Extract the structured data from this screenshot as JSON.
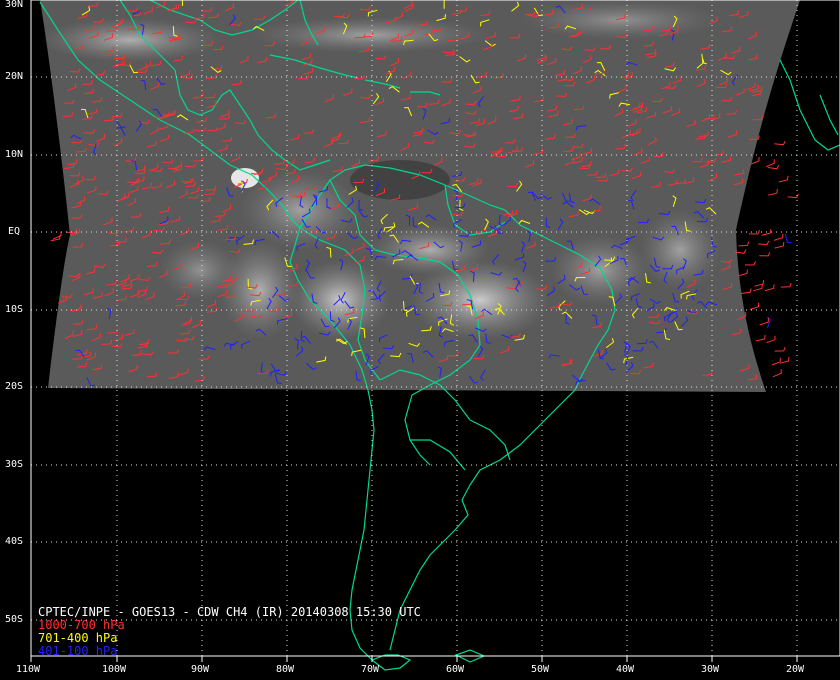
{
  "title": "CPTEC/INPE - GOES13 - CDW CH4 (IR) 20140308 15:30 UTC",
  "legend": [
    {
      "label": "1000-700 hPa",
      "color": "#ff3030"
    },
    {
      "label": "701-400 hPa",
      "color": "#ffff00"
    },
    {
      "label": "401-100 hPa",
      "color": "#2020ff"
    }
  ],
  "lat_labels": [
    "30N",
    "20N",
    "10N",
    "EQ",
    "10S",
    "20S",
    "30S",
    "40S",
    "50S"
  ],
  "lon_labels": [
    "110W",
    "100W",
    "90W",
    "80W",
    "70W",
    "60W",
    "50W",
    "40W",
    "30W",
    "20W"
  ],
  "colors": {
    "coastline": "#00d890",
    "grid": "#e0e0e0",
    "background": "#000000",
    "satellite_gray": "#5a5a5a"
  }
}
